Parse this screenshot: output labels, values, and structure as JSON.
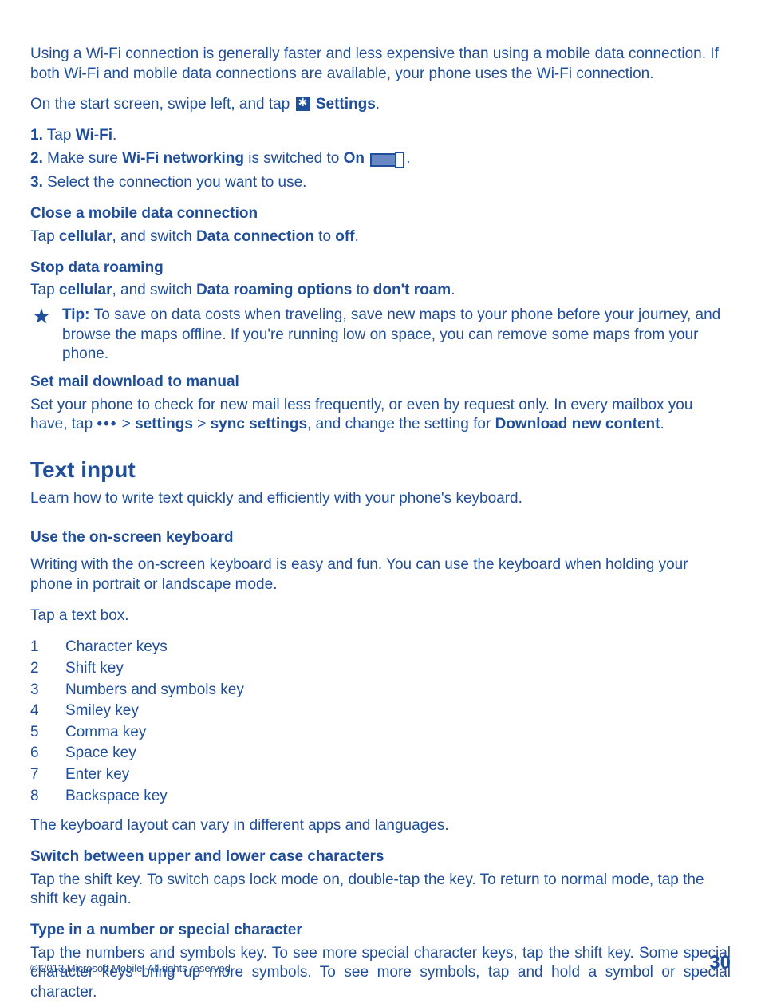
{
  "intro": "Using a Wi-Fi connection is generally faster and less expensive than using a mobile data connection. If both Wi-Fi and mobile data connections are available, your phone uses the Wi-Fi connection.",
  "start_screen": {
    "pre": "On the start screen, swipe left, and tap ",
    "settings": "Settings",
    "post": "."
  },
  "steps": {
    "s1": {
      "num": "1.",
      "pre": " Tap ",
      "bold": "Wi-Fi",
      "post": "."
    },
    "s2": {
      "num": "2.",
      "pre": " Make sure ",
      "b1": "Wi-Fi networking",
      "mid": " is switched to ",
      "b2": "On",
      "post": "."
    },
    "s3": {
      "num": "3.",
      "text": " Select the connection you want to use."
    }
  },
  "close_data": {
    "heading": "Close a mobile data connection",
    "pre": "Tap ",
    "b1": "cellular",
    "mid": ", and switch ",
    "b2": "Data connection",
    "mid2": " to ",
    "b3": "off",
    "post": "."
  },
  "stop_roaming": {
    "heading": "Stop data roaming",
    "pre": "Tap ",
    "b1": "cellular",
    "mid": ", and switch ",
    "b2": "Data roaming options",
    "mid2": " to ",
    "b3": "don't roam",
    "post": "."
  },
  "tip": {
    "label": "Tip: ",
    "text": "To save on data costs when traveling, save new maps to your phone before your journey, and browse the maps offline. If you're running low on space, you can remove some maps from your phone."
  },
  "mail": {
    "heading": "Set mail download to manual",
    "line1": "Set your phone to check for new mail less frequently, or even by request only. In every mailbox you have, tap ",
    "gt1": " > ",
    "b1": "settings",
    "gt2": " > ",
    "b2": "sync settings",
    "mid": ", and change the setting for ",
    "b3": "Download new content",
    "post": "."
  },
  "text_input": {
    "heading": "Text input",
    "sub": "Learn how to write text quickly and efficiently with your phone's keyboard."
  },
  "onscreen": {
    "heading": "Use the on-screen keyboard",
    "p1": "Writing with the on-screen keyboard is easy and fun. You can use the keyboard when holding your phone in portrait or landscape mode.",
    "p2": "Tap a text box."
  },
  "keys": [
    {
      "n": "1",
      "t": "Character keys"
    },
    {
      "n": "2",
      "t": "Shift key"
    },
    {
      "n": "3",
      "t": "Numbers and symbols key"
    },
    {
      "n": "4",
      "t": "Smiley key"
    },
    {
      "n": "5",
      "t": "Comma key"
    },
    {
      "n": "6",
      "t": "Space key"
    },
    {
      "n": "7",
      "t": "Enter key"
    },
    {
      "n": "8",
      "t": "Backspace key"
    }
  ],
  "layout_note": "The keyboard layout can vary in different apps and languages.",
  "switch_case": {
    "heading": "Switch between upper and lower case characters",
    "text": "Tap the shift key. To switch caps lock mode on, double-tap the key. To return to normal mode, tap the shift key again."
  },
  "type_special": {
    "heading": "Type in a number or special character",
    "text": "Tap the numbers and symbols key. To see more special character keys, tap the shift key. Some special character keys bring up more symbols. To see more symbols, tap and hold a symbol or special character."
  },
  "footer": {
    "copy": "© 2013 Microsoft Mobile. All rights reserved.",
    "page": "30"
  }
}
